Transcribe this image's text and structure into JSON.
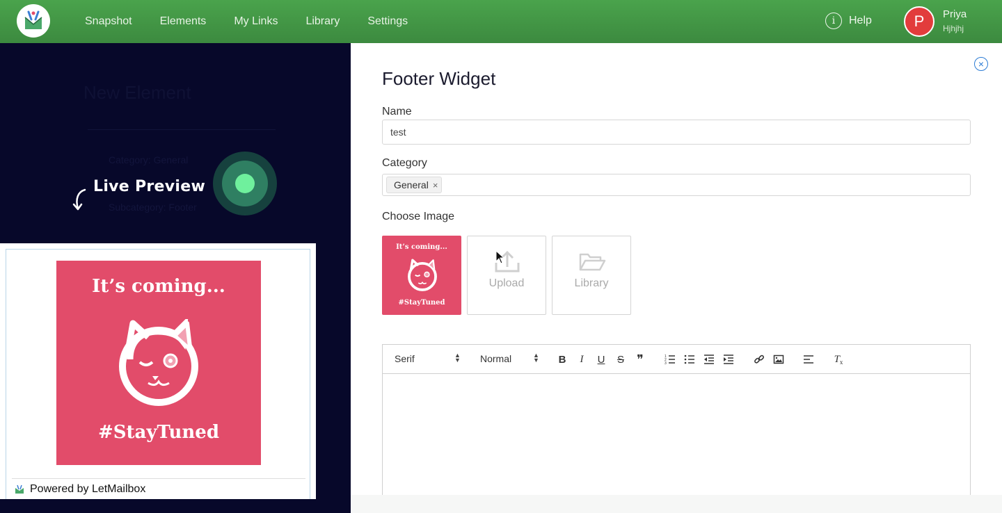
{
  "nav": {
    "items": [
      {
        "label": "Snapshot"
      },
      {
        "label": "Elements"
      },
      {
        "label": "My Links"
      },
      {
        "label": "Library"
      },
      {
        "label": "Settings"
      }
    ],
    "help_label": "Help",
    "help_icon": "info-icon"
  },
  "user": {
    "initial": "P",
    "name": "Priya",
    "subtitle": "Hjhjhj"
  },
  "background": {
    "title": "New Element",
    "text_1": "Category: General",
    "text_2": "Subcategory: Footer"
  },
  "live_preview": {
    "label": "Live Preview",
    "powered_by": "Powered by LetMailbox",
    "image_title": "It’s coming...",
    "image_tag": "#StayTuned"
  },
  "panel": {
    "title": "Footer Widget",
    "name_label": "Name",
    "name_value": "test",
    "category_label": "Category",
    "category_tag": "General",
    "category_tag_remove": "×",
    "choose_image_label": "Choose Image",
    "selected_image_title": "It’s coming...",
    "selected_image_tag": "#StayTuned",
    "upload_label": "Upload",
    "library_label": "Library",
    "close_symbol": "×"
  },
  "editor": {
    "font_value": "Serif",
    "size_value": "Normal",
    "bold": "B",
    "italic": "I",
    "underline": "U",
    "strike": "S",
    "quote": "❞",
    "clean": "T"
  },
  "colors": {
    "nav_green": "#3f8f42",
    "overlay": "#07082a",
    "brand_pink": "#e24c6a",
    "avatar_red": "#e23c3c",
    "accent_blue": "#2b7bd4",
    "pulse_green": "#6ff09d"
  }
}
